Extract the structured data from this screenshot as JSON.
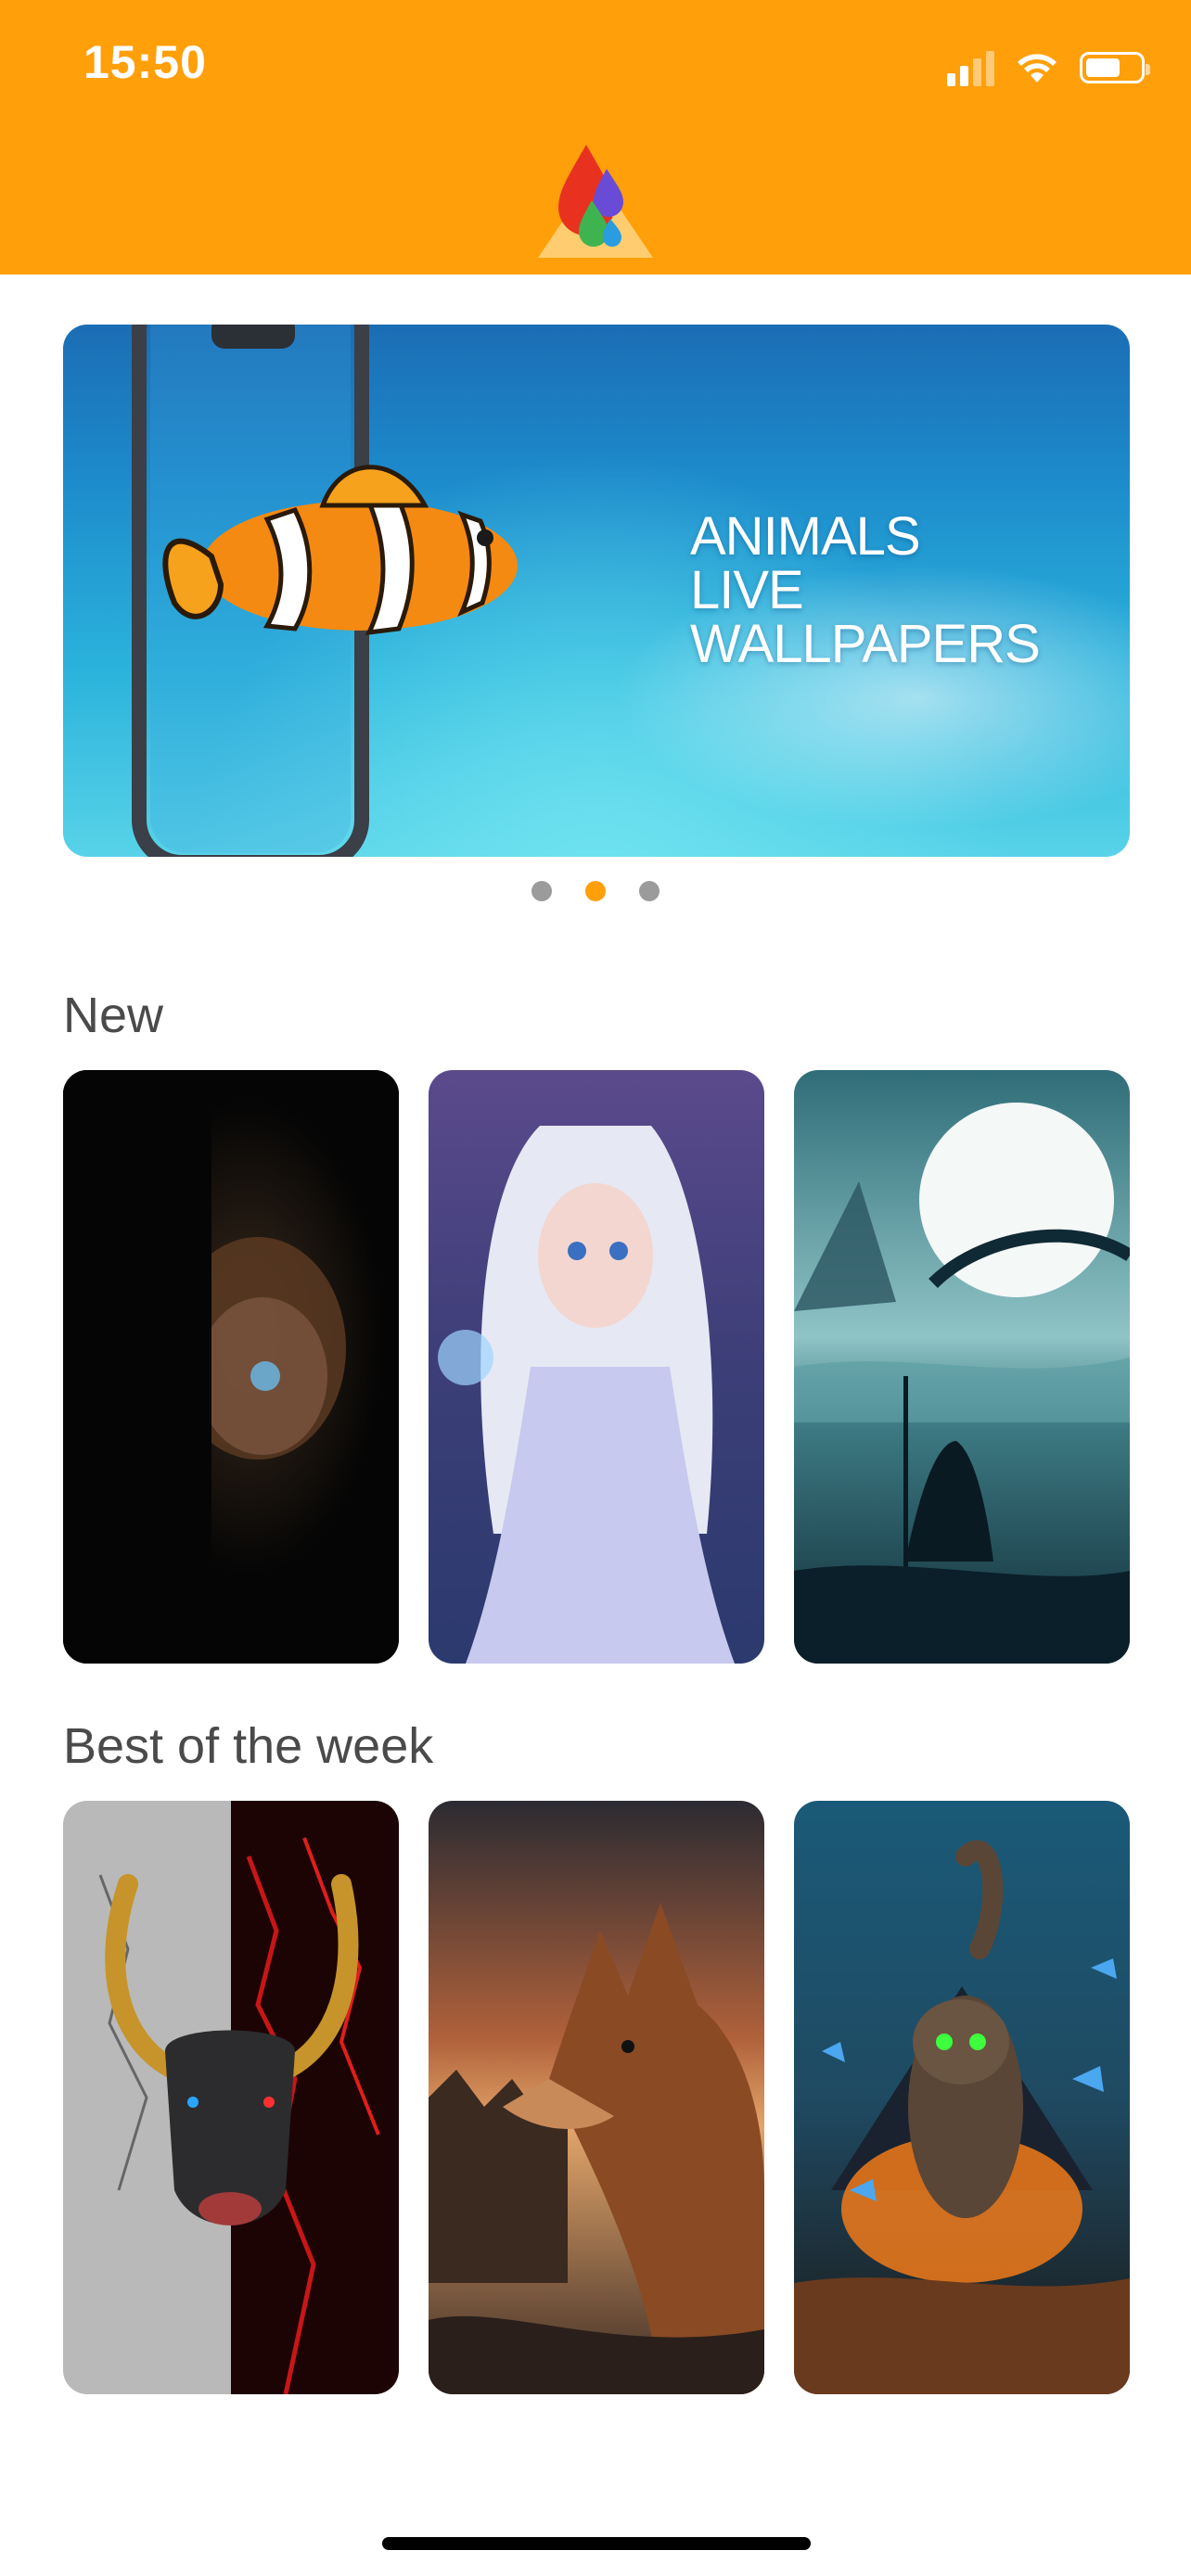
{
  "status_bar": {
    "time": "15:50"
  },
  "banner": {
    "lines": [
      "ANIMALS",
      "LIVE",
      "WALLPAPERS"
    ],
    "page_count": 3,
    "active_page": 2
  },
  "sections": [
    {
      "title": "New",
      "items": [
        {
          "subject": "doll-in-shadow"
        },
        {
          "subject": "ice-princess"
        },
        {
          "subject": "moonlit-lake-wanderer"
        }
      ]
    },
    {
      "title": "Best of the week",
      "items": [
        {
          "subject": "bull-red-cracks"
        },
        {
          "subject": "fox-sunset-forest"
        },
        {
          "subject": "cat-butterflies-pyramid"
        }
      ]
    }
  ],
  "colors": {
    "accent": "#FF9F0A",
    "dot_inactive": "#9b9b9b",
    "title_text": "#4a4a4a"
  }
}
